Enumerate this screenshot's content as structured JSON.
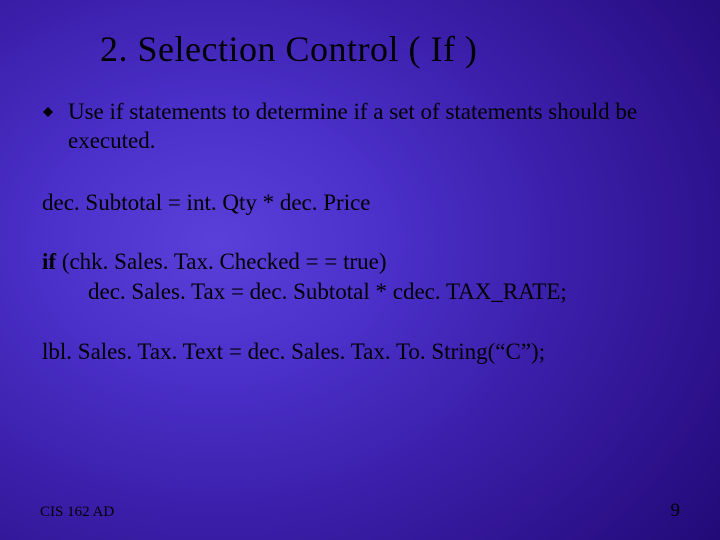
{
  "title": "2. Selection Control ( If )",
  "bullet": "Use if statements to determine if a set of statements should be executed.",
  "code1": "dec. Subtotal = int. Qty * dec. Price",
  "code2_bold": "if",
  "code2_rest": " (chk. Sales. Tax. Checked = = true)",
  "code2_line2": "dec. Sales. Tax = dec. Subtotal * cdec. TAX_RATE;",
  "code3": "lbl. Sales. Tax. Text = dec. Sales. Tax. To. String(“C”);",
  "footer_left": "CIS 162 AD",
  "footer_right": "9"
}
